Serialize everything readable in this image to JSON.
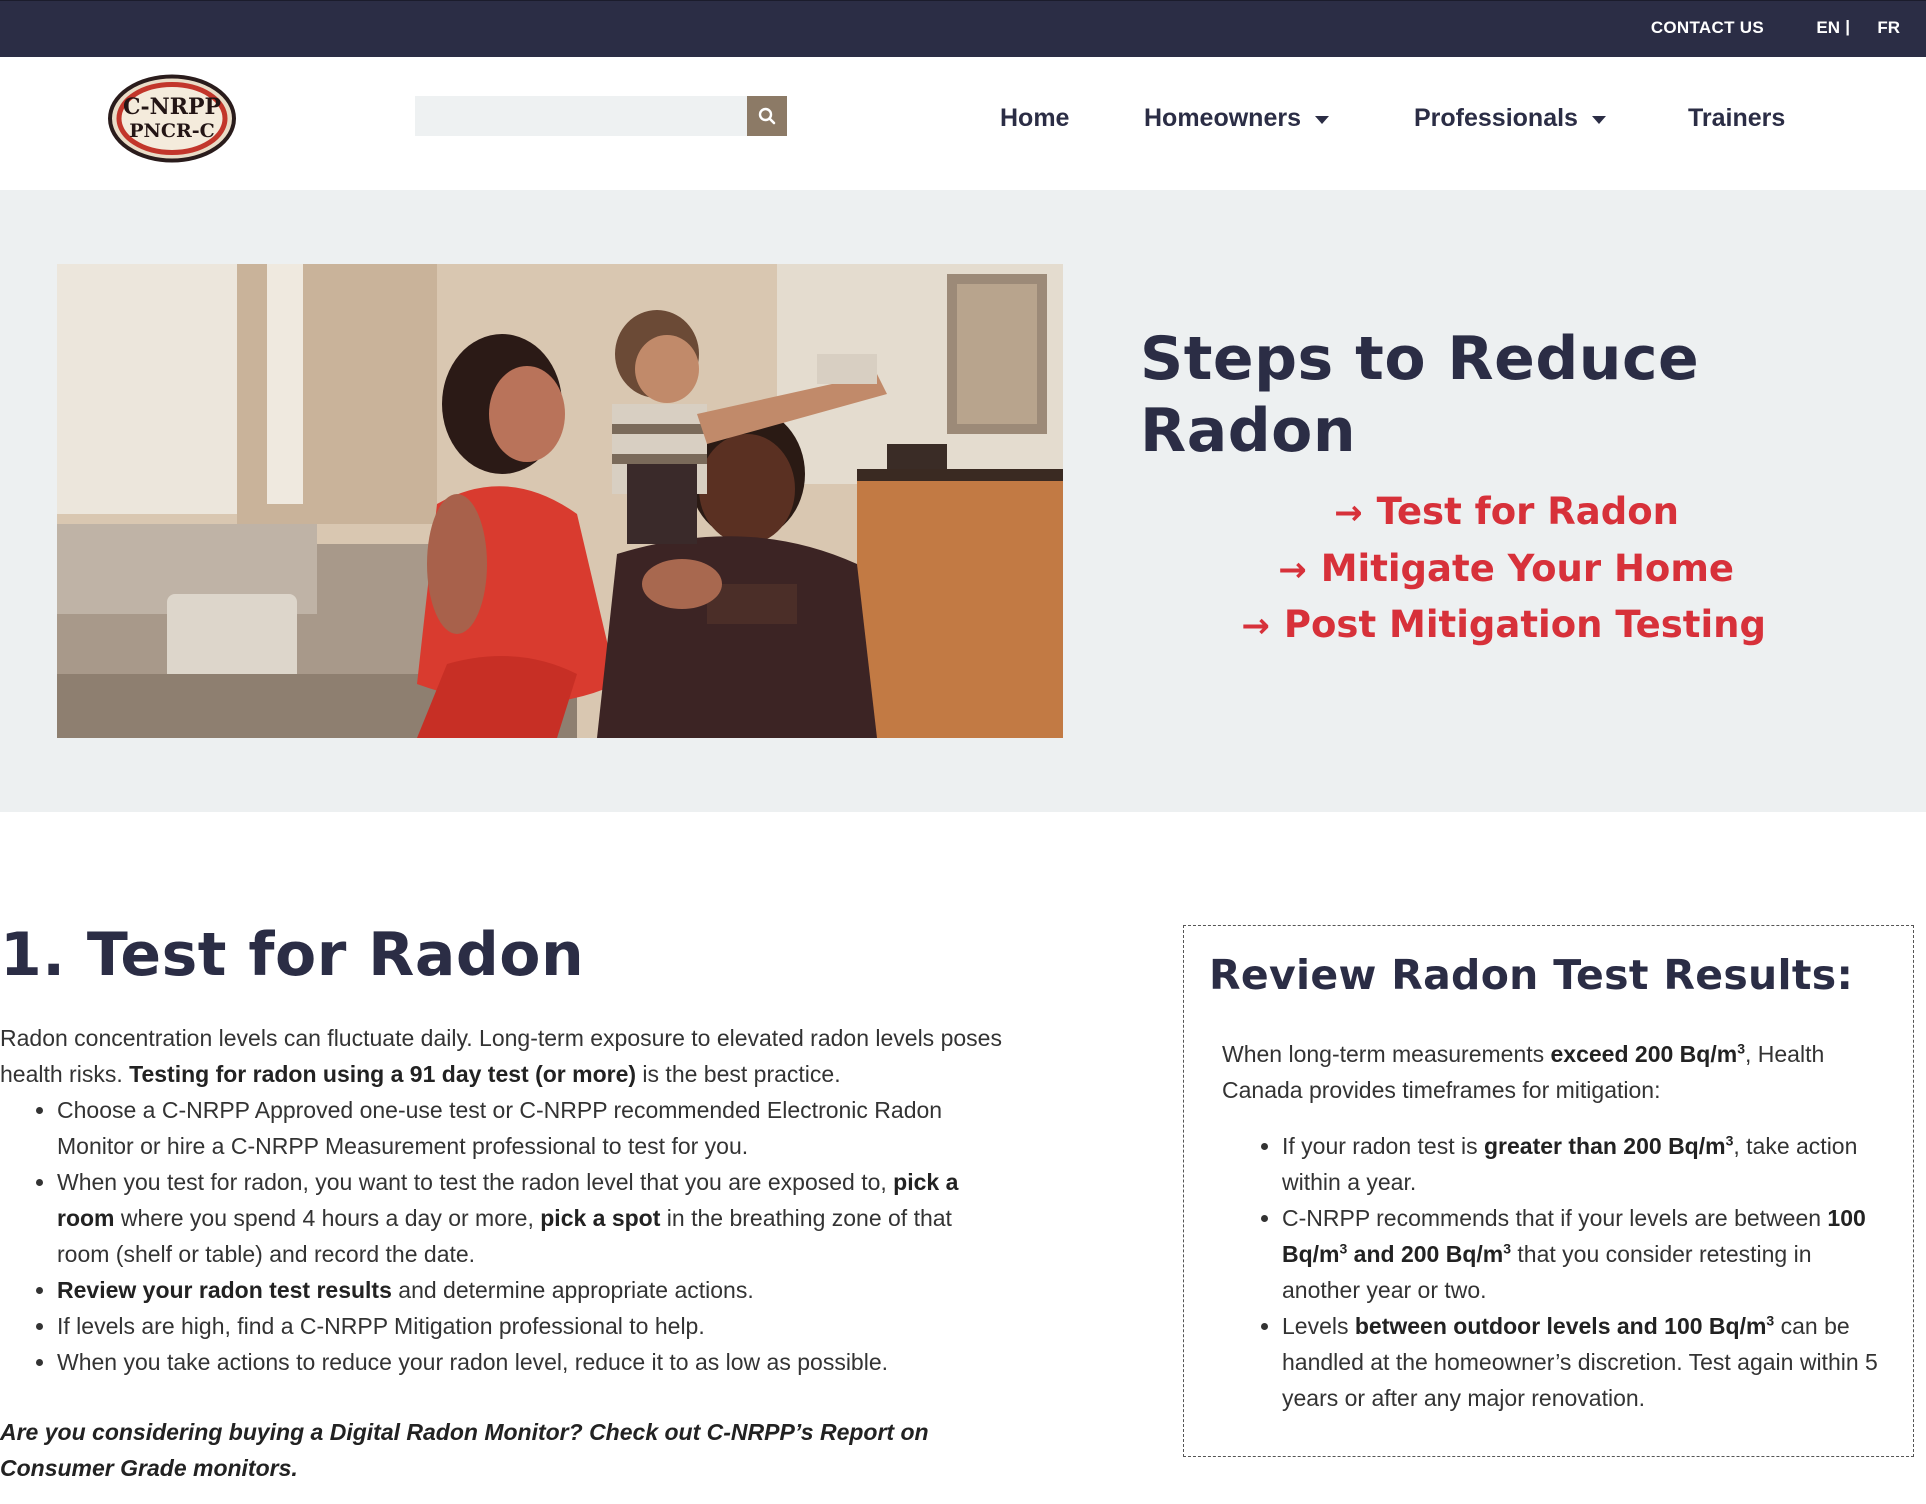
{
  "topbar": {
    "contact_label": "CONTACT US",
    "lang_en": "EN",
    "lang_sep": "|",
    "lang_fr": "FR"
  },
  "header": {
    "logo_line1": "C-NRPP",
    "logo_line2": "PNCR-C",
    "search_placeholder": "",
    "search_icon": "search-icon",
    "nav": {
      "home": "Home",
      "homeowners": "Homeowners",
      "professionals": "Professionals",
      "trainers": "Trainers"
    }
  },
  "hero": {
    "title": "Steps to Reduce Radon",
    "links": [
      {
        "label": "Test for Radon"
      },
      {
        "label": "Mitigate Your Home"
      },
      {
        "label": "Post Mitigation Testing"
      }
    ],
    "arrow_glyph": "→"
  },
  "section1": {
    "title": "1. Test for Radon",
    "intro_a": "Radon concentration levels can fluctuate daily. Long-term exposure to elevated radon levels poses health risks. ",
    "intro_b": "Testing for radon using a 91 day test (or more)",
    "intro_c": " is the best practice.",
    "bullets": {
      "b1": "Choose a C-NRPP Approved one-use test or C-NRPP recommended Electronic Radon Monitor or hire a C-NRPP Measurement professional to test for you.",
      "b2_a": "When you test for radon, you want to test the radon level that you are exposed to, ",
      "b2_b": "pick a room",
      "b2_c": " where you spend 4 hours a day or more, ",
      "b2_d": "pick a spot",
      "b2_e": " in the breathing zone of that room (shelf or table) and record the date.",
      "b3_a": "Review your radon test results",
      "b3_b": " and determine appropriate actions.",
      "b4": "If levels are high, find a C-NRPP Mitigation professional to help.",
      "b5": "When you take actions to reduce your radon level, reduce it to as low as possible."
    },
    "note": "Are you considering buying a Digital Radon Monitor? Check out C-NRPP’s Report on Consumer Grade monitors."
  },
  "review": {
    "title": "Review Radon Test Results:",
    "intro_a": "When long-term measurements ",
    "intro_b": "exceed 200 Bq/m",
    "intro_c": ", Health Canada provides timeframes for mitigation:",
    "sup": "3",
    "b1_a": "If your radon test is ",
    "b1_b": "greater than 200 Bq/m",
    "b1_c": ", take action within a year.",
    "b2_a": "C-NRPP recommends that if your levels are between ",
    "b2_b": "100 Bq/m",
    "b2_c": " and 200 Bq/m",
    "b2_d": " that you consider retesting in another year or two.",
    "b3_a": "Levels ",
    "b3_b": "between outdoor levels and 100 Bq/m",
    "b3_c": " can be handled at the homeowner’s discretion. Test again within 5 years or after any major renovation."
  },
  "colors": {
    "navy": "#2b2d45",
    "accent_red": "#d7313a",
    "hero_bg": "#edf0f1",
    "search_btn": "#8c7a66"
  }
}
